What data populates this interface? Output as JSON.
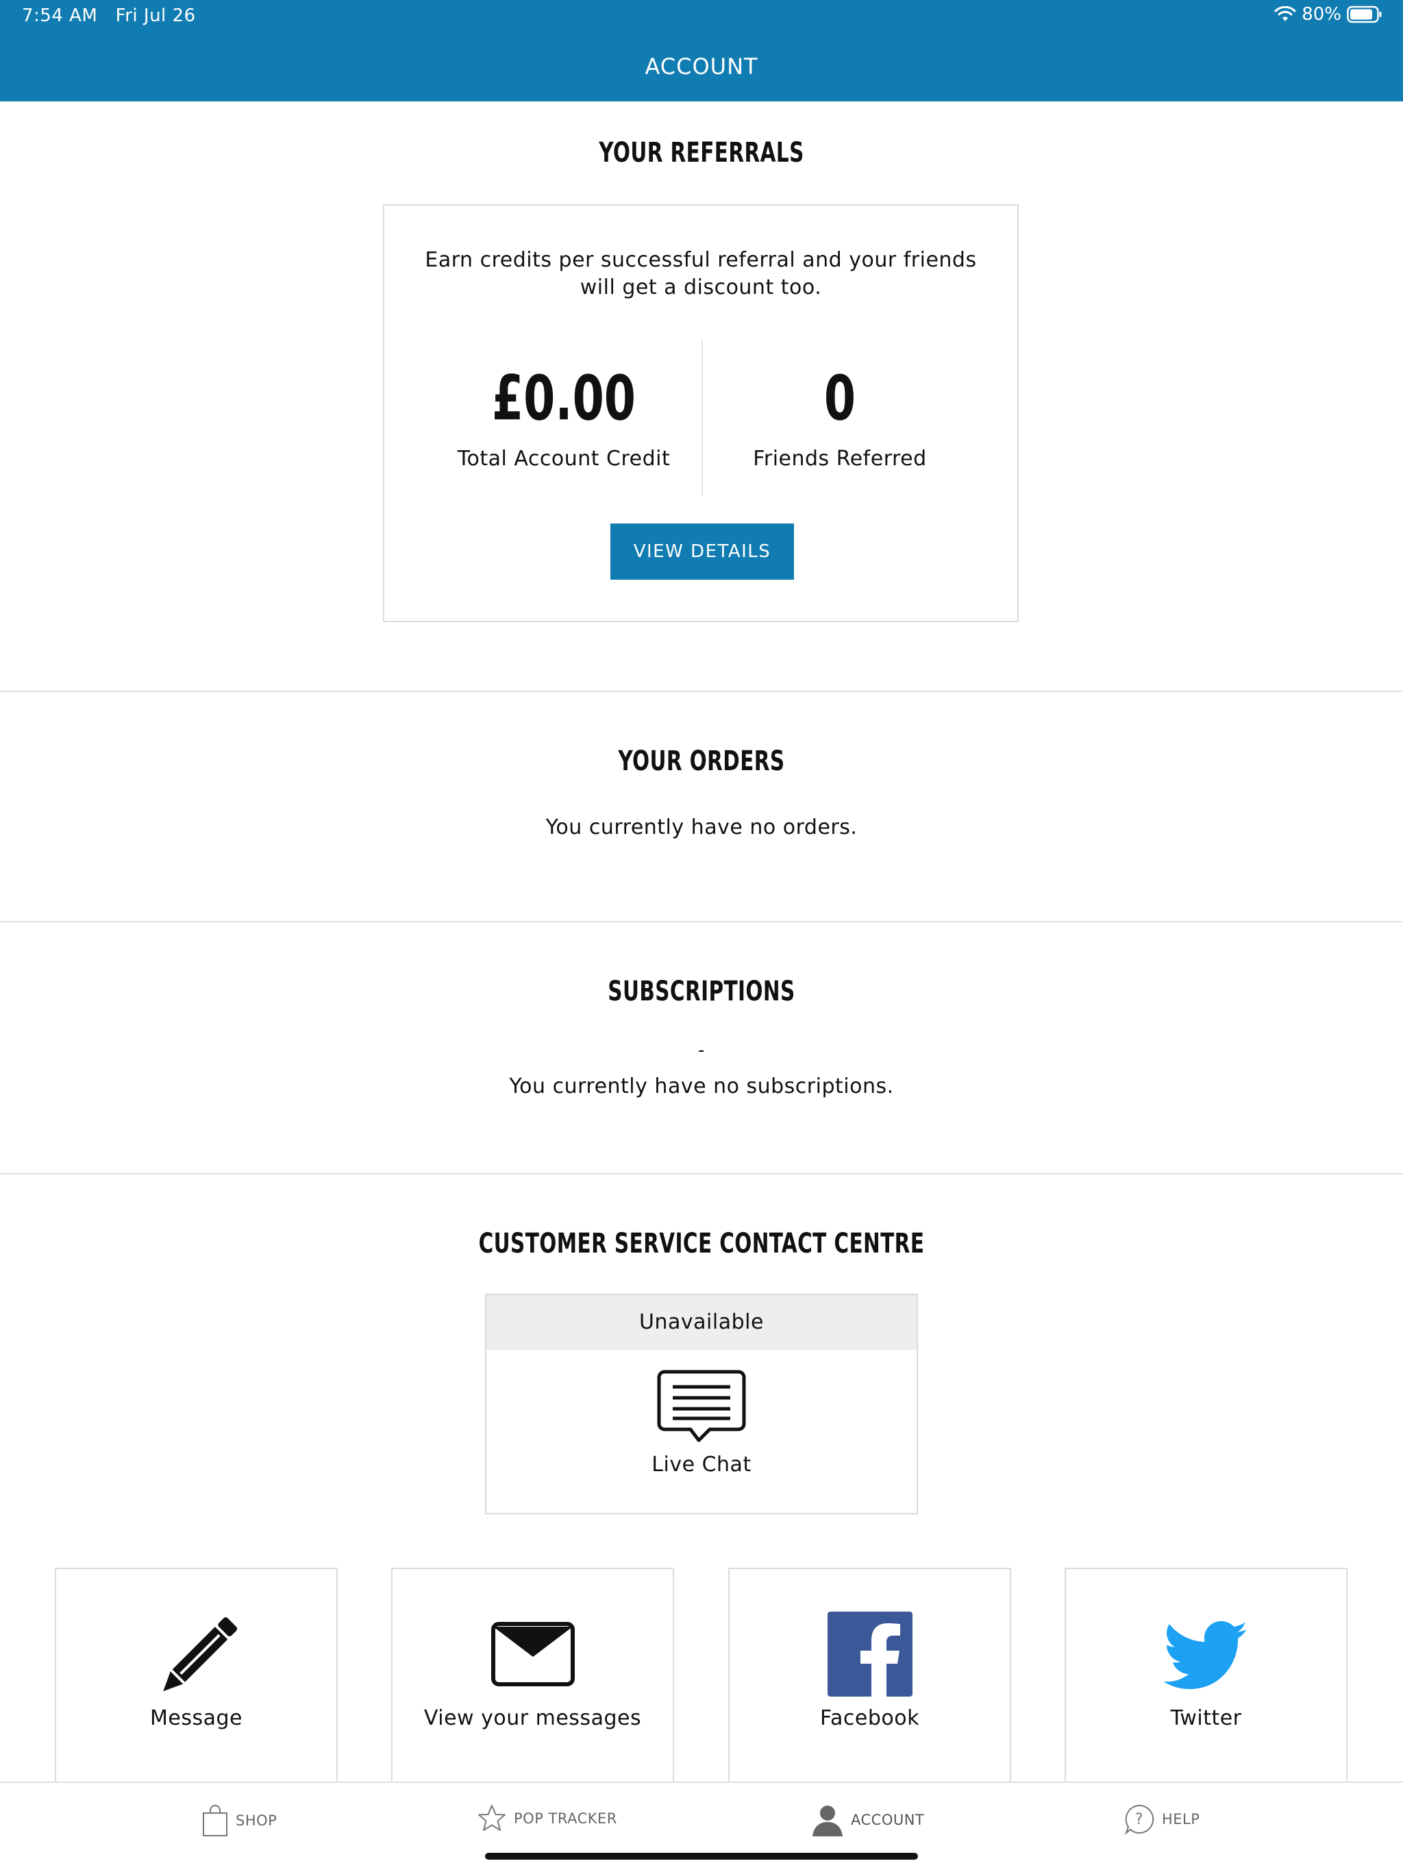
{
  "status_bar": {
    "time": "7:54 AM",
    "date": "Fri Jul 26",
    "battery": "80%"
  },
  "header": {
    "title": "ACCOUNT"
  },
  "referrals": {
    "heading": "YOUR REFERRALS",
    "description": "Earn credits per successful referral and your friends will get a discount too.",
    "credit_value": "£0.00",
    "credit_label": "Total Account Credit",
    "friends_value": "0",
    "friends_label": "Friends Referred",
    "button_label": "VIEW DETAILS"
  },
  "orders": {
    "heading": "YOUR ORDERS",
    "message": "You currently have no orders."
  },
  "subscriptions": {
    "heading": "SUBSCRIPTIONS",
    "dash": "-",
    "message": "You currently have no subscriptions."
  },
  "contact": {
    "heading": "CUSTOMER SERVICE CONTACT CENTRE",
    "chat_status": "Unavailable",
    "chat_label": "Live Chat",
    "tiles": [
      {
        "label": "Message",
        "icon": "pencil-icon"
      },
      {
        "label": "View your messages",
        "icon": "envelope-icon"
      },
      {
        "label": "Facebook",
        "icon": "facebook-icon"
      },
      {
        "label": "Twitter",
        "icon": "twitter-icon"
      }
    ]
  },
  "tabbar": {
    "items": [
      {
        "label": "SHOP",
        "icon": "shopping-bag-icon"
      },
      {
        "label": "POP TRACKER",
        "icon": "star-icon"
      },
      {
        "label": "ACCOUNT",
        "icon": "person-icon",
        "active": true
      },
      {
        "label": "HELP",
        "icon": "help-icon"
      }
    ]
  },
  "colors": {
    "brand": "#117cb1",
    "facebook": "#3b5998",
    "twitter": "#1da1f2"
  }
}
